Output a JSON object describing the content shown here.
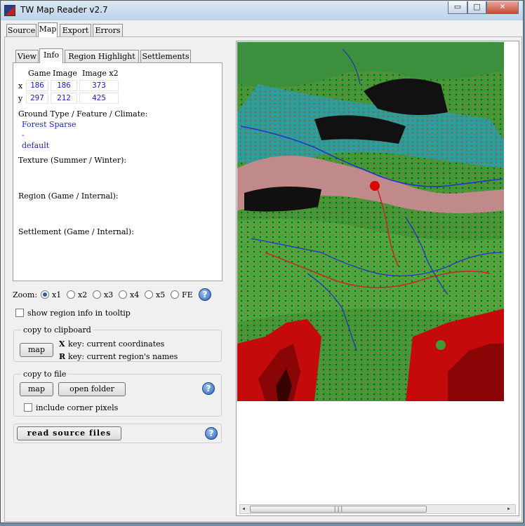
{
  "window": {
    "title": "TW Map Reader v2.7",
    "minimize_glyph": "▭",
    "maximize_glyph": "□",
    "close_glyph": "✕"
  },
  "main_tabs": [
    "Source",
    "Map",
    "Export",
    "Errors"
  ],
  "main_tab_active": "Map",
  "sub_tabs": [
    "View",
    "Info",
    "Region Highlight",
    "Settlements"
  ],
  "sub_tab_active": "Info",
  "info": {
    "coord_headers": [
      "Game",
      "Image",
      "Image x2"
    ],
    "rows": [
      {
        "axis": "x",
        "game": "186",
        "image": "186",
        "image_x2": "373"
      },
      {
        "axis": "y",
        "game": "297",
        "image": "212",
        "image_x2": "425"
      }
    ],
    "ground_label": "Ground Type / Feature / Climate:",
    "ground_type": "Forest Sparse",
    "feature": "-",
    "climate": "default",
    "texture_label": "Texture (Summer / Winter):",
    "region_label": "Region (Game / Internal):",
    "settlement_label": "Settlement (Game / Internal):"
  },
  "zoom": {
    "label": "Zoom:",
    "options": [
      "x1",
      "x2",
      "x3",
      "x4",
      "x5",
      "FE"
    ],
    "selected": "x1"
  },
  "tooltip_checkbox": {
    "label": "show region info in tooltip",
    "checked": false
  },
  "clipboard": {
    "title": "copy to clipboard",
    "button": "map",
    "key1": "X",
    "key1_text": "key: current coordinates",
    "key2": "R",
    "key2_text": "key: current region's names"
  },
  "file": {
    "title": "copy to file",
    "map_button": "map",
    "folder_button": "open folder",
    "corner_checkbox": {
      "label": "include corner pixels",
      "checked": false
    }
  },
  "read_button": "read source files",
  "help_glyph": "?",
  "map_scroll": {
    "left_arrow": "◂",
    "right_arrow": "▸",
    "grip": "|||"
  }
}
